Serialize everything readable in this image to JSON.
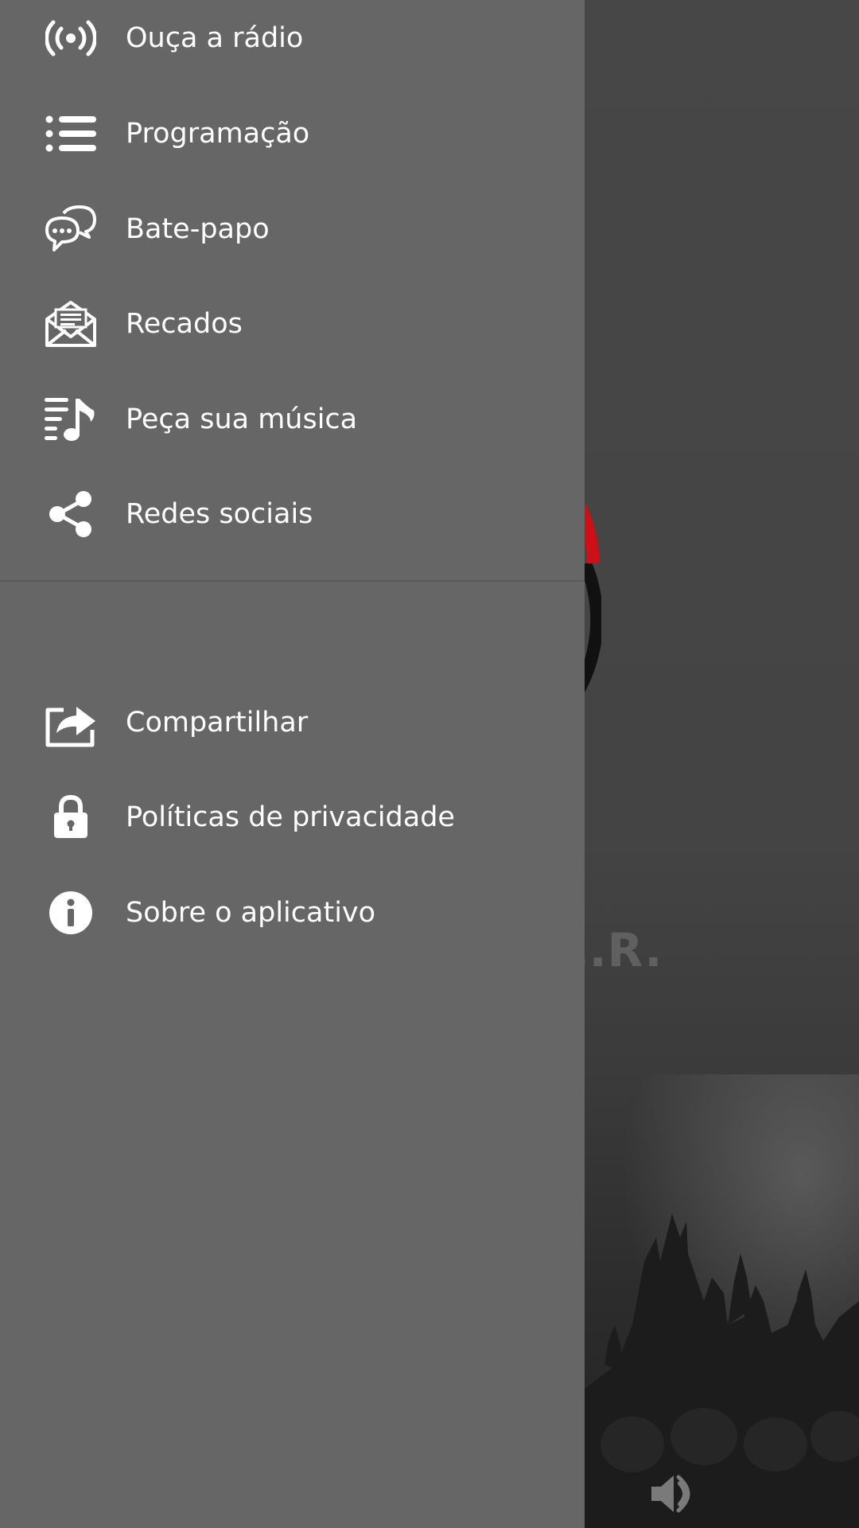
{
  "drawer": {
    "primary_items": [
      {
        "label": "Ouça a rádio",
        "icon": "broadcast-icon"
      },
      {
        "label": "Programação",
        "icon": "list-icon"
      },
      {
        "label": "Bate-papo",
        "icon": "chat-bubbles-icon"
      },
      {
        "label": "Recados",
        "icon": "envelope-letter-icon"
      },
      {
        "label": "Peça sua música",
        "icon": "playlist-music-icon"
      },
      {
        "label": "Redes sociais",
        "icon": "share-icon"
      }
    ],
    "secondary_items": [
      {
        "label": "Compartilhar",
        "icon": "share-box-icon"
      },
      {
        "label": "Políticas de privacidade",
        "icon": "lock-icon"
      },
      {
        "label": "Sobre o aplicativo",
        "icon": "info-icon"
      }
    ]
  },
  "background": {
    "station_name_partial": "E.R.",
    "volume_icon": "volume-icon"
  },
  "colors": {
    "drawer_bg": "#666666",
    "text": "#ffffff",
    "logo_red": "#cc1016",
    "logo_black": "#111111"
  }
}
